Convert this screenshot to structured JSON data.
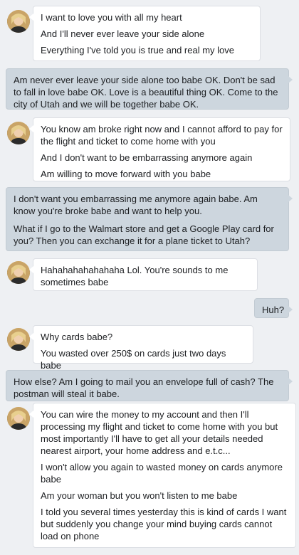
{
  "messages": [
    {
      "from": "them",
      "lines": [
        "I want to love you with all my heart",
        "And I'll never ever leave your side alone",
        "Everything I've told you is true and real my love"
      ]
    },
    {
      "from": "me",
      "lines": [
        "Am never ever leave your side alone too babe OK. Don't be sad to fall in love babe OK. Love is a beautiful thing OK. Come to the city of Utah and we will be together babe OK."
      ]
    },
    {
      "from": "them",
      "lines": [
        "You know am broke right now and I cannot afford to pay for the flight and ticket to come home with you",
        "And I don't want to be embarrassing anymore again",
        "Am willing to move forward with you babe"
      ]
    },
    {
      "from": "me",
      "lines": [
        "I don't want you embarrassing me anymore again babe. Am know you're broke babe and want to help you.",
        "What if I go to the Walmart store and get a Google Play card for you? Then you can exchange it for a plane ticket to Utah?"
      ]
    },
    {
      "from": "them",
      "lines": [
        "Hahahahahahahaha Lol. You're sounds to me sometimes babe"
      ]
    },
    {
      "from": "me",
      "lines": [
        "Huh?"
      ]
    },
    {
      "from": "them",
      "lines": [
        "Why cards babe?",
        "You wasted over 250$ on cards just two days babe"
      ]
    },
    {
      "from": "me",
      "lines": [
        "How else? Am I going to mail you an envelope full of cash? The postman will steal it babe."
      ]
    },
    {
      "from": "them",
      "lines": [
        "You can wire the money to my account and then I'll processing my flight and ticket to come home with you but most importantly I'll have to get all your details needed nearest airport, your home address and e.t.c...",
        "I won't allow you again to wasted money on cards anymore babe",
        "Am your woman but you won't listen to me babe",
        "I told you several times yesterday this is kind of cards I want but suddenly you change your mind buying cards cannot load on phone"
      ]
    }
  ]
}
